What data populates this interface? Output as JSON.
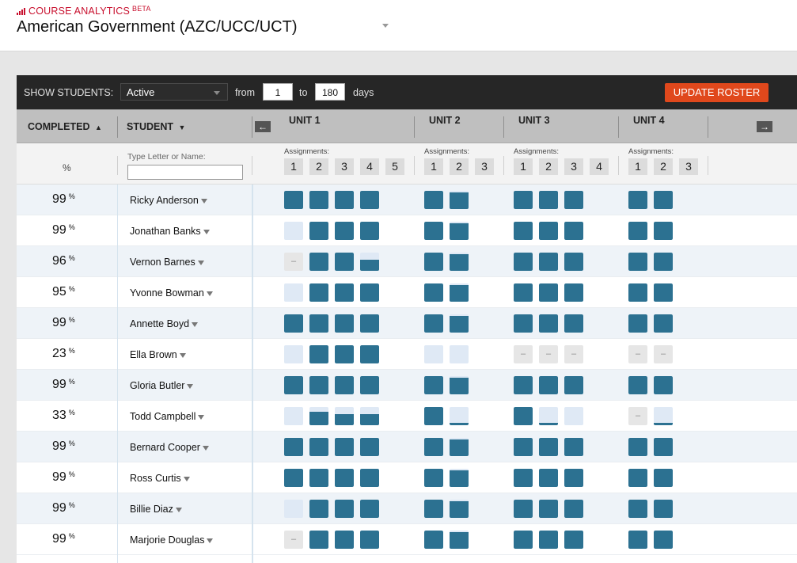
{
  "header": {
    "brand": "COURSE ANALYTICS",
    "badge": "BETA",
    "course_title": "American Government (AZC/UCC/UCT)"
  },
  "toolbar": {
    "show_label": "SHOW STUDENTS:",
    "filter_value": "Active",
    "from_label": "from",
    "from_value": "1",
    "to_label": "to",
    "to_value": "180",
    "days_label": "days",
    "update_button": "UPDATE ROSTER"
  },
  "columns": {
    "completed": "COMPLETED",
    "completed_icon": "sort-icon",
    "student": "STUDENT",
    "student_icon": "caret-down-icon",
    "percent_symbol": "%",
    "filter_placeholder": "Type Letter or Name:",
    "assignments_label": "Assignments:",
    "prev_icon": "arrow-left-icon",
    "next_icon": "arrow-right-icon"
  },
  "units": [
    {
      "name": "UNIT 1",
      "assignments": [
        "1",
        "2",
        "3",
        "4",
        "5"
      ]
    },
    {
      "name": "UNIT 2",
      "assignments": [
        "1",
        "2",
        "3"
      ]
    },
    {
      "name": "UNIT 3",
      "assignments": [
        "1",
        "2",
        "3",
        "4"
      ]
    },
    {
      "name": "UNIT 4",
      "assignments": [
        "1",
        "2",
        "3"
      ]
    }
  ],
  "colors": {
    "completed": "#2c7191",
    "not_started": "#dfe9f5",
    "not_available": "#e6e6e6",
    "accent": "#e0481c",
    "brand": "#c8102e"
  },
  "students": [
    {
      "name": "Ricky Anderson",
      "completed": "99",
      "units": [
        [
          1,
          1,
          1,
          1
        ],
        [
          1,
          0.9
        ],
        [
          1,
          1,
          1
        ],
        [
          1,
          1
        ]
      ]
    },
    {
      "name": "Jonathan Banks",
      "completed": "99",
      "units": [
        [
          0,
          1,
          1,
          1
        ],
        [
          1,
          0.9
        ],
        [
          1,
          1,
          1
        ],
        [
          1,
          1
        ]
      ]
    },
    {
      "name": "Vernon Barnes",
      "completed": "96",
      "units": [
        [
          -1,
          1,
          1,
          0.6
        ],
        [
          1,
          0.9
        ],
        [
          1,
          1,
          1
        ],
        [
          1,
          1
        ]
      ]
    },
    {
      "name": "Yvonne Bowman",
      "completed": "95",
      "units": [
        [
          0,
          1,
          1,
          1
        ],
        [
          1,
          0.9
        ],
        [
          1,
          1,
          1
        ],
        [
          1,
          1
        ]
      ]
    },
    {
      "name": "Annette Boyd",
      "completed": "99",
      "units": [
        [
          1,
          1,
          1,
          1
        ],
        [
          1,
          0.9
        ],
        [
          1,
          1,
          1
        ],
        [
          1,
          1
        ]
      ]
    },
    {
      "name": "Ella Brown",
      "completed": "23",
      "units": [
        [
          0,
          1,
          1,
          1
        ],
        [
          0,
          0
        ],
        [
          -1,
          -1,
          -1
        ],
        [
          -1,
          -1
        ]
      ]
    },
    {
      "name": "Gloria Butler",
      "completed": "99",
      "units": [
        [
          1,
          1,
          1,
          1
        ],
        [
          1,
          0.9
        ],
        [
          1,
          1,
          1
        ],
        [
          1,
          1
        ]
      ]
    },
    {
      "name": "Todd Campbell",
      "completed": "33",
      "units": [
        [
          0,
          0.75,
          0.6,
          0.6
        ],
        [
          1,
          0.15
        ],
        [
          1,
          0.15,
          0
        ],
        [
          -1,
          0.15
        ]
      ]
    },
    {
      "name": "Bernard Cooper",
      "completed": "99",
      "units": [
        [
          1,
          1,
          1,
          1
        ],
        [
          1,
          0.9
        ],
        [
          1,
          1,
          1
        ],
        [
          1,
          1
        ]
      ]
    },
    {
      "name": "Ross Curtis",
      "completed": "99",
      "units": [
        [
          1,
          1,
          1,
          1
        ],
        [
          1,
          0.9
        ],
        [
          1,
          1,
          1
        ],
        [
          1,
          1
        ]
      ]
    },
    {
      "name": "Billie Diaz",
      "completed": "99",
      "units": [
        [
          0,
          1,
          1,
          1
        ],
        [
          1,
          0.9
        ],
        [
          1,
          1,
          1
        ],
        [
          1,
          1
        ]
      ]
    },
    {
      "name": "Marjorie Douglas",
      "completed": "99",
      "units": [
        [
          -1,
          1,
          1,
          1
        ],
        [
          1,
          0.9
        ],
        [
          1,
          1,
          1
        ],
        [
          1,
          1
        ]
      ]
    }
  ]
}
